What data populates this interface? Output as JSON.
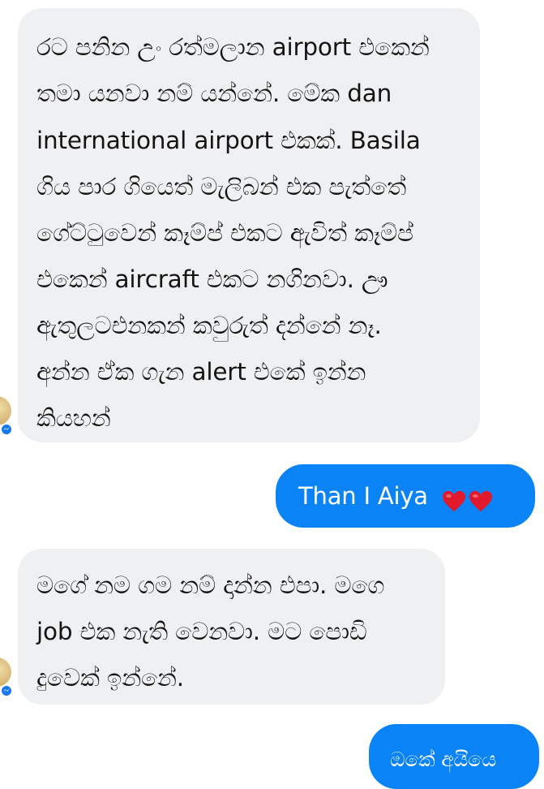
{
  "conversation": {
    "messages": [
      {
        "direction": "incoming",
        "lines": [
          "රට පනින උං රත්මලාන airport එකෙන්",
          "තමා යනවා නම් යන්නේ. මේක dan",
          "international airport එකක්. Basila",
          "ගිය පාර ගියෙත් මැලිබන් එක පැත්තේ",
          "ගේට්ටුවෙන් කෑම්ප් එකට ඇවිත් කෑම්ප්",
          "එකෙන් aircraft එකට නගිනවා.  ඌ",
          "ඇතුලටඑනකන් කවුරුත් දන්නේ නෑ.",
          "අන්න ඒක ගැන alert එකේ ඉන්න",
          "කියහන්"
        ]
      },
      {
        "direction": "outgoing",
        "text": "Than I Aiya",
        "emoji": "red-heart-icon red-heart-icon"
      },
      {
        "direction": "incoming",
        "lines": [
          "මගේ නම ගම නම් දාන්න එපා. මගෙ",
          "job එක නැති වෙනවා. මට පොඩි",
          "දුවෙක් ඉන්නේ."
        ]
      },
      {
        "direction": "outgoing",
        "text": "ඔකේ අයියෙ"
      }
    ]
  },
  "colors": {
    "incoming_bubble": "#eff0f2",
    "outgoing_bubble": "#0a83f7",
    "incoming_text": "#141414",
    "outgoing_text": "#ffffff",
    "heart": "#e0192d",
    "badge": "#1877f2"
  }
}
